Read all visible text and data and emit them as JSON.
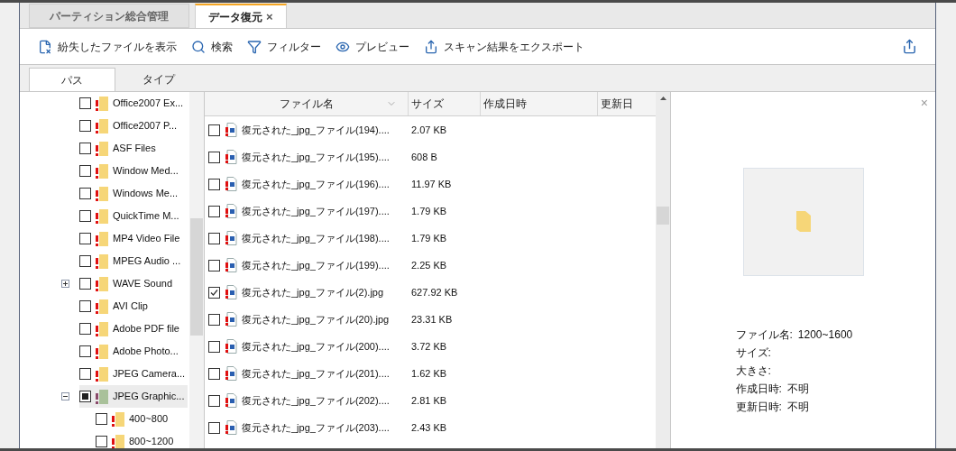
{
  "tabs": [
    {
      "label": "パーティション総合管理",
      "selected": false
    },
    {
      "label": "データ復元",
      "selected": true,
      "close": "×"
    }
  ],
  "toolbar": [
    {
      "label": "紛失したファイルを表示"
    },
    {
      "label": "検索"
    },
    {
      "label": "フィルター"
    },
    {
      "label": "プレビュー"
    },
    {
      "label": "スキャン結果をエクスポート"
    }
  ],
  "view_tabs": [
    {
      "label": "パス",
      "selected": true
    },
    {
      "label": "タイプ",
      "selected": false
    }
  ],
  "tree": [
    {
      "label": "Office2007 Ex...",
      "checked": false,
      "mixed": false,
      "selected": false
    },
    {
      "label": "Office2007 P...",
      "checked": false,
      "mixed": false,
      "selected": false
    },
    {
      "label": "ASF Files",
      "checked": false,
      "mixed": false,
      "selected": false
    },
    {
      "label": "Window Med...",
      "checked": false,
      "mixed": false,
      "selected": false
    },
    {
      "label": "Windows Me...",
      "checked": false,
      "mixed": false,
      "selected": false
    },
    {
      "label": "QuickTime M...",
      "checked": false,
      "mixed": false,
      "selected": false
    },
    {
      "label": "MP4 Video File",
      "checked": false,
      "mixed": false,
      "selected": false
    },
    {
      "label": "MPEG Audio ...",
      "checked": false,
      "mixed": false,
      "selected": false
    },
    {
      "label": "WAVE Sound",
      "checked": false,
      "mixed": false,
      "selected": false,
      "expanded": false
    },
    {
      "label": "AVI Clip",
      "checked": false,
      "mixed": false,
      "selected": false
    },
    {
      "label": "Adobe PDF file",
      "checked": false,
      "mixed": false,
      "selected": false
    },
    {
      "label": "Adobe Photo...",
      "checked": false,
      "mixed": false,
      "selected": false
    },
    {
      "label": "JPEG Camera...",
      "checked": false,
      "mixed": false,
      "selected": false
    },
    {
      "label": "JPEG Graphic...",
      "checked": false,
      "mixed": true,
      "selected": true,
      "expanded": true,
      "children": [
        {
          "label": "400~800",
          "checked": false,
          "mixed": false,
          "selected": false
        },
        {
          "label": "800~1200",
          "checked": false,
          "mixed": false,
          "selected": false
        }
      ]
    }
  ],
  "table": {
    "columns": [
      "ファイル名",
      "サイズ",
      "作成日時",
      "更新日"
    ],
    "rows": [
      {
        "name": "復元された_jpg_ファイル(194)....",
        "size": "2.07 KB",
        "checked": false
      },
      {
        "name": "復元された_jpg_ファイル(195)....",
        "size": "608 B",
        "checked": false
      },
      {
        "name": "復元された_jpg_ファイル(196)....",
        "size": "11.97 KB",
        "checked": false
      },
      {
        "name": "復元された_jpg_ファイル(197)....",
        "size": "1.79 KB",
        "checked": false
      },
      {
        "name": "復元された_jpg_ファイル(198)....",
        "size": "1.79 KB",
        "checked": false
      },
      {
        "name": "復元された_jpg_ファイル(199)....",
        "size": "2.25 KB",
        "checked": false
      },
      {
        "name": "復元された_jpg_ファイル(2).jpg",
        "size": "627.92 KB",
        "checked": true
      },
      {
        "name": "復元された_jpg_ファイル(20).jpg",
        "size": "23.31 KB",
        "checked": false
      },
      {
        "name": "復元された_jpg_ファイル(200)....",
        "size": "3.72 KB",
        "checked": false
      },
      {
        "name": "復元された_jpg_ファイル(201)....",
        "size": "1.62 KB",
        "checked": false
      },
      {
        "name": "復元された_jpg_ファイル(202)....",
        "size": "2.81 KB",
        "checked": false
      },
      {
        "name": "復元された_jpg_ファイル(203)....",
        "size": "2.43 KB",
        "checked": false
      }
    ]
  },
  "preview": {
    "close": "×",
    "info": [
      {
        "label": "ファイル名:",
        "value": "1200~1600"
      },
      {
        "label": "サイズ:"
      },
      {
        "label": "大きさ:"
      },
      {
        "label": "作成日時:",
        "value": "不明"
      },
      {
        "label": "更新日時:",
        "value": "不明"
      }
    ]
  }
}
